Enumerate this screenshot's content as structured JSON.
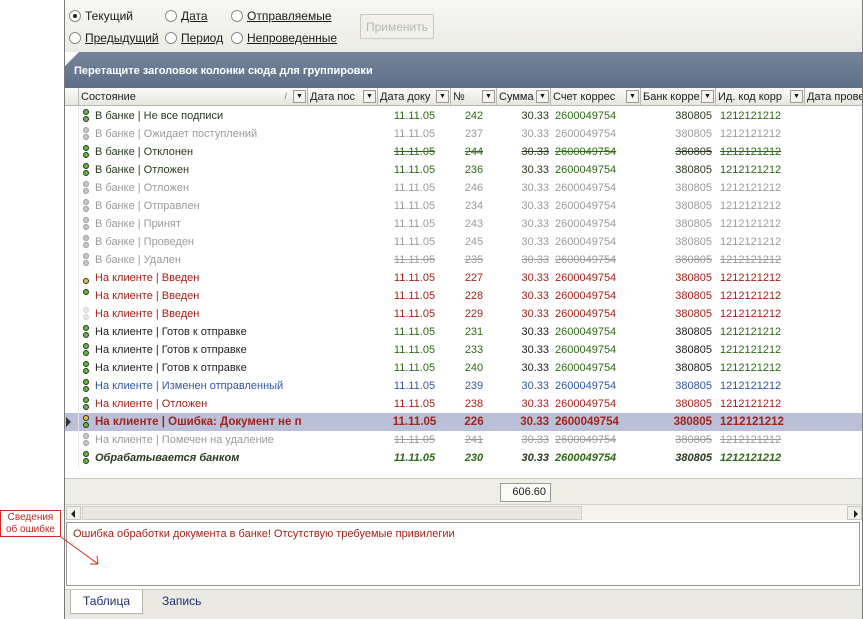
{
  "filters": {
    "options": [
      {
        "label": "Текущий",
        "selected": true
      },
      {
        "label": "Дата",
        "selected": false
      },
      {
        "label": "Отправляемые",
        "selected": false
      },
      {
        "label": "Предыдущий",
        "selected": false
      },
      {
        "label": "Период",
        "selected": false
      },
      {
        "label": "Непроведенные",
        "selected": false
      }
    ],
    "apply_label": "Применить"
  },
  "group_panel": {
    "text": "Перетащите заголовок колонки сюда для группировки"
  },
  "grid": {
    "columns": [
      {
        "label": "Состояние"
      },
      {
        "label": "Дата пос"
      },
      {
        "label": "Дата доку"
      },
      {
        "label": "№"
      },
      {
        "label": "Сумма"
      },
      {
        "label": "Счет коррес"
      },
      {
        "label": "Банк корре"
      },
      {
        "label": "Ид. код корр"
      },
      {
        "label": "Дата прове"
      }
    ],
    "rows": [
      {
        "status": "В банке | Не все подписи",
        "date_doc": "11.11.05",
        "num": "242",
        "amount": "30.33",
        "account": "2600049754",
        "bank": "380805",
        "code": "1212121212",
        "style": "greentxt",
        "icon": "gg"
      },
      {
        "status": "В банке | Ожидает поступлений",
        "date_doc": "11.11.05",
        "num": "237",
        "amount": "30.33",
        "account": "2600049754",
        "bank": "380805",
        "code": "1212121212",
        "style": "dim",
        "icon": "gray"
      },
      {
        "status": "В банке | Отклонен",
        "date_doc": "11.11.05",
        "num": "244",
        "amount": "30.33",
        "account": "2600049754",
        "bank": "380805",
        "code": "1212121212",
        "style": "greentxt strike",
        "icon": "gg"
      },
      {
        "status": "В банке | Отложен",
        "date_doc": "11.11.05",
        "num": "236",
        "amount": "30.33",
        "account": "2600049754",
        "bank": "380805",
        "code": "1212121212",
        "style": "greentxt",
        "icon": "gg"
      },
      {
        "status": "В банке | Отложен",
        "date_doc": "11.11.05",
        "num": "246",
        "amount": "30.33",
        "account": "2600049754",
        "bank": "380805",
        "code": "1212121212",
        "style": "dim",
        "icon": "gray"
      },
      {
        "status": "В банке | Отправлен",
        "date_doc": "11.11.05",
        "num": "234",
        "amount": "30.33",
        "account": "2600049754",
        "bank": "380805",
        "code": "1212121212",
        "style": "dim",
        "icon": "gray"
      },
      {
        "status": "В банке | Принят",
        "date_doc": "11.11.05",
        "num": "243",
        "amount": "30.33",
        "account": "2600049754",
        "bank": "380805",
        "code": "1212121212",
        "style": "dim",
        "icon": "gray"
      },
      {
        "status": "В банке | Проведен",
        "date_doc": "11.11.05",
        "num": "245",
        "amount": "30.33",
        "account": "2600049754",
        "bank": "380805",
        "code": "1212121212",
        "style": "dim",
        "icon": "gray"
      },
      {
        "status": "В банке | Удален",
        "date_doc": "11.11.05",
        "num": "235",
        "amount": "30.33",
        "account": "2600049754",
        "bank": "380805",
        "code": "1212121212",
        "style": "dim strike",
        "icon": "gray"
      },
      {
        "status": "На клиенте | Введен",
        "date_doc": "11.11.05",
        "num": "227",
        "amount": "30.33",
        "account": "2600049754",
        "bank": "380805",
        "code": "1212121212",
        "style": "red",
        "icon": "one"
      },
      {
        "status": "На клиенте | Введен",
        "date_doc": "11.11.05",
        "num": "228",
        "amount": "30.33",
        "account": "2600049754",
        "bank": "380805",
        "code": "1212121212",
        "style": "red",
        "icon": "top"
      },
      {
        "status": "На клиенте | Введен",
        "date_doc": "11.11.05",
        "num": "229",
        "amount": "30.33",
        "account": "2600049754",
        "bank": "380805",
        "code": "1212121212",
        "style": "red",
        "icon": "faint"
      },
      {
        "status": "На клиенте | Готов к отправке",
        "date_doc": "11.11.05",
        "num": "231",
        "amount": "30.33",
        "account": "2600049754",
        "bank": "380805",
        "code": "1212121212",
        "style": "blk",
        "icon": "gg"
      },
      {
        "status": "На клиенте | Готов к отправке",
        "date_doc": "11.11.05",
        "num": "233",
        "amount": "30.33",
        "account": "2600049754",
        "bank": "380805",
        "code": "1212121212",
        "style": "blk",
        "icon": "gg"
      },
      {
        "status": "На клиенте | Готов к отправке",
        "date_doc": "11.11.05",
        "num": "240",
        "amount": "30.33",
        "account": "2600049754",
        "bank": "380805",
        "code": "1212121212",
        "style": "blk",
        "icon": "gg"
      },
      {
        "status": "На клиенте | Изменен отправленный",
        "date_doc": "11.11.05",
        "num": "239",
        "amount": "30.33",
        "account": "2600049754",
        "bank": "380805",
        "code": "1212121212",
        "style": "blue",
        "icon": "gg"
      },
      {
        "status": "На клиенте | Отложен",
        "date_doc": "11.11.05",
        "num": "238",
        "amount": "30.33",
        "account": "2600049754",
        "bank": "380805",
        "code": "1212121212",
        "style": "red",
        "icon": "gg"
      },
      {
        "status": "На клиенте | Ошибка: Документ не п",
        "date_doc": "11.11.05",
        "num": "226",
        "amount": "30.33",
        "account": "2600049754",
        "bank": "380805",
        "code": "1212121212",
        "style": "red bold",
        "icon": "yg",
        "selected": true
      },
      {
        "status": "На клиенте | Помечен на удаление",
        "date_doc": "11.11.05",
        "num": "241",
        "amount": "30.33",
        "account": "2600049754",
        "bank": "380805",
        "code": "1212121212",
        "style": "dim strike",
        "icon": "gray"
      },
      {
        "status": "Обрабатывается банком",
        "date_doc": "11.11.05",
        "num": "230",
        "amount": "30.33",
        "account": "2600049754",
        "bank": "380805",
        "code": "1212121212",
        "style": "greentxt italic",
        "icon": "gg"
      }
    ]
  },
  "summary": {
    "total": "606.60"
  },
  "error_panel": {
    "text": "Ошибка обработки документа в банке! Отсутствую требуемые привилегии"
  },
  "tabs": [
    {
      "label": "Таблица",
      "active": true
    },
    {
      "label": "Запись",
      "active": false
    }
  ],
  "callout": {
    "line1": "Сведения",
    "line2": "об ошибке"
  }
}
